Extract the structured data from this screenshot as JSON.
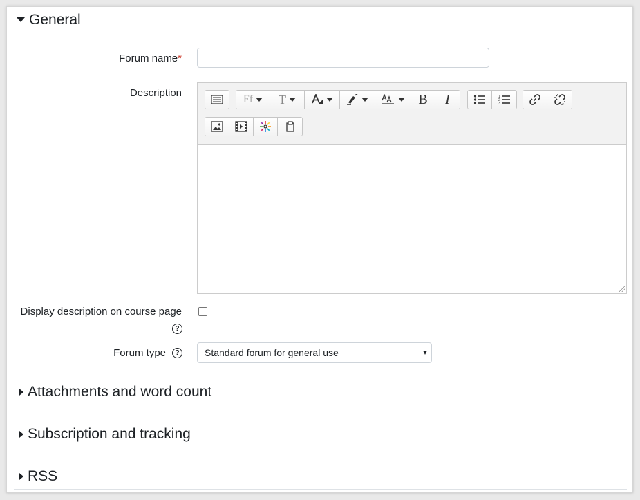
{
  "sections": {
    "general": {
      "title": "General"
    },
    "attachments": {
      "title": "Attachments and word count"
    },
    "subscription": {
      "title": "Subscription and tracking"
    },
    "rss": {
      "title": "RSS"
    }
  },
  "form": {
    "forum_name_label": "Forum name",
    "required_marker": "*",
    "forum_name_value": "",
    "description_label": "Description",
    "display_description_label": "Display description on course page",
    "forum_type_label": "Forum type",
    "forum_type_selected": "Standard forum for general use",
    "help_glyph": "?"
  },
  "toolbar": {
    "font_family_glyph": "Ff",
    "font_size_glyph": "T",
    "bold": "B",
    "italic": "I",
    "icons": [
      "toolbar-toggle-icon",
      "font-family-icon",
      "font-size-icon",
      "font-color-icon",
      "background-color-icon",
      "text-style-icon",
      "bold-icon",
      "italic-icon",
      "unordered-list-icon",
      "ordered-list-icon",
      "link-icon",
      "unlink-icon",
      "image-icon",
      "media-icon",
      "equation-icon",
      "paste-icon"
    ]
  }
}
